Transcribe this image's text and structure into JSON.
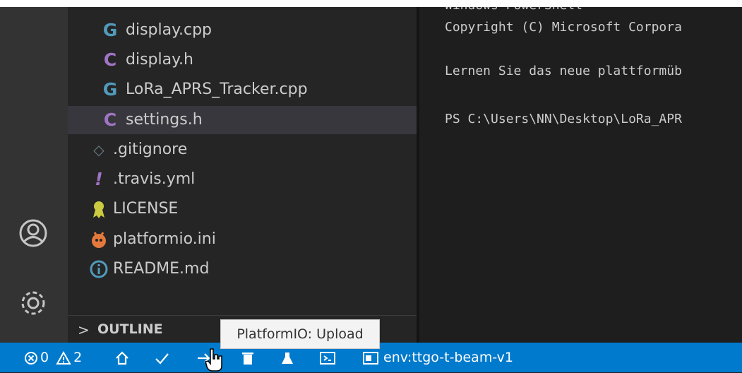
{
  "colors": {
    "statusbar": "#007acc",
    "activity_bar": "#333333",
    "sidebar": "#252526",
    "editor_bg": "#1e1e1e",
    "selected_row": "#37373d",
    "cpp_icon": "#519aba",
    "c_icon": "#a074c4",
    "license_icon": "#cbcb41",
    "platformio_icon": "#e5793c",
    "info_icon": "#519aba"
  },
  "activity_bar": {
    "icons": [
      "account-icon",
      "settings-gear-icon"
    ]
  },
  "explorer": {
    "files": [
      {
        "icon": "G",
        "icon_name": "cpp-file-icon",
        "label": "display.cpp"
      },
      {
        "icon": "C",
        "icon_name": "c-header-file-icon",
        "label": "display.h"
      },
      {
        "icon": "G",
        "icon_name": "cpp-file-icon",
        "label": "LoRa_APRS_Tracker.cpp"
      },
      {
        "icon": "C",
        "icon_name": "c-header-file-icon",
        "label": "settings.h"
      },
      {
        "icon": "◇",
        "icon_name": "gitignore-file-icon",
        "label": ".gitignore"
      },
      {
        "icon": "!",
        "icon_name": "yaml-file-icon",
        "label": ".travis.yml"
      },
      {
        "icon": "🎗",
        "icon_name": "license-file-icon",
        "label": "LICENSE"
      },
      {
        "icon": "🐜",
        "icon_name": "platformio-file-icon",
        "label": "platformio.ini"
      },
      {
        "icon": "ⓘ",
        "icon_name": "readme-info-icon",
        "label": "README.md"
      }
    ],
    "selected_file": "settings.h",
    "outline": {
      "chevron": ">",
      "label": "OUTLINE"
    }
  },
  "terminal": {
    "lines": [
      "Windows PowerShell",
      "Copyright (C) Microsoft Corpora",
      "",
      "Lernen Sie das neue plattformüb",
      "",
      "PS C:\\Users\\NN\\Desktop\\LoRa_APR"
    ]
  },
  "statusbar": {
    "errors": "0",
    "warnings": "2",
    "items": [
      "home-icon",
      "build-check-icon",
      "upload-arrow-icon",
      "clean-trash-icon",
      "test-flask-icon",
      "serial-monitor-icon",
      "terminal-icon"
    ],
    "env_label": "env:ttgo-t-beam-v1"
  },
  "tooltip": {
    "text": "PlatformIO: Upload"
  }
}
